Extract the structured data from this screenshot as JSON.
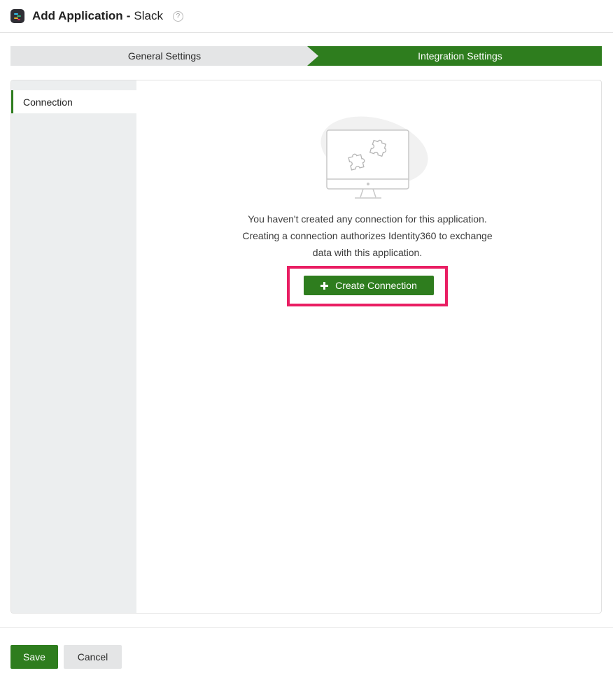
{
  "header": {
    "title_prefix": "Add Application",
    "separator": "-",
    "app_name": "Slack",
    "help_icon": "?"
  },
  "steps": [
    {
      "label": "General Settings",
      "active": false
    },
    {
      "label": "Integration Settings",
      "active": true
    }
  ],
  "sidebar": {
    "items": [
      {
        "label": "Connection",
        "selected": true
      }
    ]
  },
  "empty_state": {
    "illustration": "monitor-puzzle-icon",
    "lines": [
      "You haven't created any connection for this application.",
      "Creating a connection authorizes Identity360 to exchange",
      "data with this application."
    ],
    "button_icon": "plus-icon",
    "button_label": "Create Connection"
  },
  "footer": {
    "save_label": "Save",
    "cancel_label": "Cancel"
  },
  "colors": {
    "accent": "#2e7d1e",
    "highlight": "#e91e63",
    "sidebar_bg": "#eceeef",
    "step_inactive": "#e4e5e6"
  }
}
